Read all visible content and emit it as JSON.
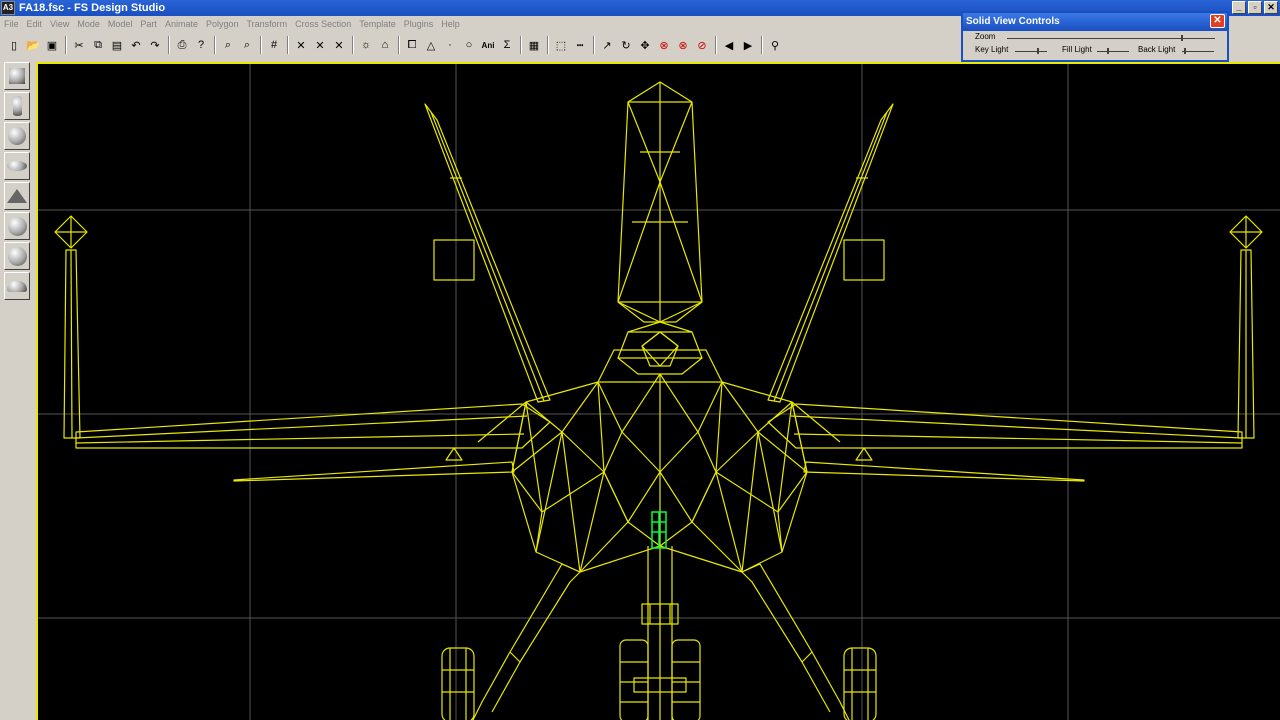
{
  "window": {
    "title": "FA18.fsc - FS Design Studio",
    "icon_label": "A3",
    "buttons": [
      "minimize-icon",
      "restore-icon",
      "close-icon"
    ]
  },
  "menu": [
    "File",
    "Edit",
    "View",
    "Mode",
    "Model",
    "Part",
    "Animate",
    "Polygon",
    "Transform",
    "Cross Section",
    "Template",
    "Plugins",
    "Help"
  ],
  "toolbar": {
    "icons": [
      "new-icon",
      "open-icon",
      "save-icon",
      "cut-icon",
      "copy-icon",
      "paste-icon",
      "undo-icon",
      "redo-icon",
      "print-icon",
      "help-icon",
      "zoom-in-icon",
      "zoom-out-icon",
      "grid-icon",
      "mirror-x-icon",
      "mirror-y-icon",
      "mirror-z-icon",
      "light-icon",
      "home-icon",
      "select-poly-icon",
      "triangle-icon",
      "point-icon",
      "circle-icon",
      "ani-icon",
      "sum-icon",
      "texture-icon",
      "select-rect-icon",
      "select-line-icon",
      "rotate-icon",
      "refresh-icon",
      "move-icon",
      "delete-poly-icon",
      "delete-point-icon",
      "delete-part-icon",
      "prev-icon",
      "next-icon",
      "binoculars-icon"
    ],
    "ani_label": "Ani"
  },
  "palette": [
    "cube-icon",
    "cylinder-icon",
    "sphere-icon",
    "ellipsoid-icon",
    "cone-icon",
    "geosphere-icon",
    "hemisphere-icon",
    "dome-icon"
  ],
  "svc": {
    "title": "Solid View Controls",
    "zoom_label": "Zoom",
    "key_label": "Key Light",
    "fill_label": "Fill Light",
    "back_label": "Back Light"
  },
  "viewport": {
    "background": "#000000",
    "wire_color": "#e8e800",
    "selection_color": "#00ff40",
    "grid_color": "#555555"
  }
}
